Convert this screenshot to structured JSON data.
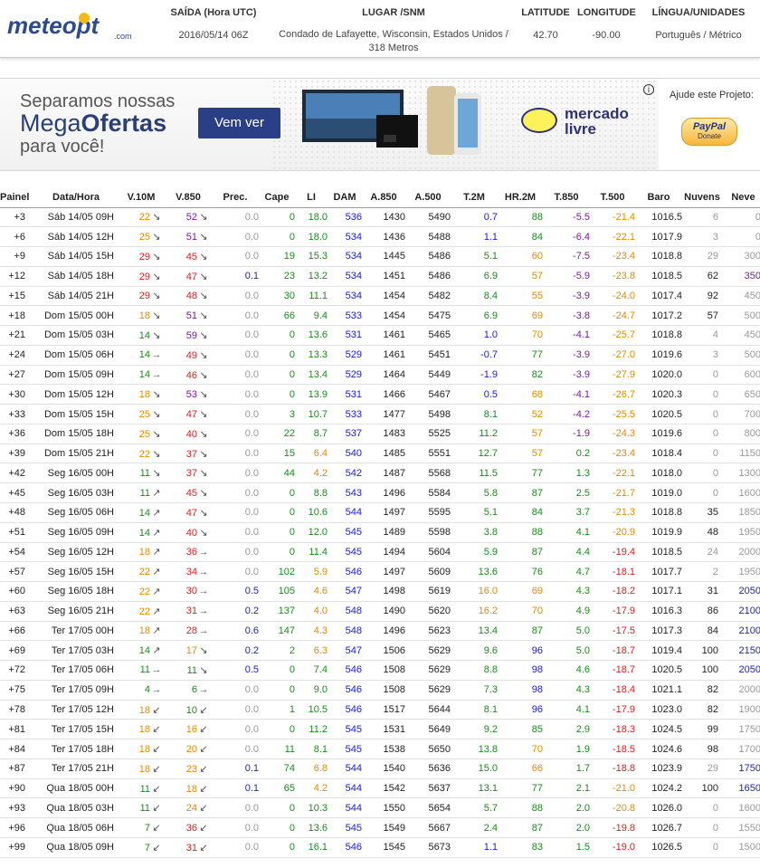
{
  "header": {
    "logo_text": "meteopt",
    "logo_suffix": ".com",
    "saida_label": "SAÍDA (Hora UTC)",
    "saida_value": "2016/05/14 06Z",
    "lugar_label": "LUGAR /SNM",
    "lugar_value_line1": "Condado de Lafayette, Wisconsin, Estados Unidos /",
    "lugar_value_line2": "318 Metros",
    "latitude_label": "LATITUDE",
    "latitude_value": "42.70",
    "longitude_label": "LONGITUDE",
    "longitude_value": "-90.00",
    "lingua_label": "LÍNGUA/UNIDADES",
    "lingua_value": "Português / Métrico"
  },
  "banner": {
    "line1": "Separamos nossas",
    "line2a": "Mega",
    "line2b": "Ofertas",
    "line3": "para você!",
    "button": "Vem ver",
    "brand_line1": "mercado",
    "brand_line2": "livre",
    "info_icon": "i",
    "support_text": "Ajude este Projeto:",
    "paypal_line1": "PayPal",
    "paypal_line2": "Donate"
  },
  "colors": {
    "green": "#1a8a1a",
    "orange": "#e08a00",
    "red": "#d42020",
    "purple": "#7a1aa0",
    "blue": "#1a1adc",
    "gray": "#999999"
  },
  "table": {
    "headers": [
      "Painel",
      "Data/Hora",
      "V.10M",
      "V.850",
      "Prec.",
      "Cape",
      "LI",
      "DAM",
      "A.850",
      "A.500",
      "T.2M",
      "HR.2M",
      "T.850",
      "T.500",
      "Baro",
      "Nuvens",
      "Neve"
    ],
    "rows": [
      [
        "+3",
        "Sáb 14/05 09H",
        "22",
        "↘",
        "52",
        "↘",
        "0.0",
        "0",
        "18.0",
        "536",
        "1430",
        "5490",
        "0.7",
        "88",
        "-5.5",
        "-21.4",
        "1016.5",
        "6",
        "0"
      ],
      [
        "+6",
        "Sáb 14/05 12H",
        "25",
        "↘",
        "51",
        "↘",
        "0.0",
        "0",
        "18.0",
        "534",
        "1436",
        "5488",
        "1.1",
        "84",
        "-6.4",
        "-22.1",
        "1017.9",
        "3",
        "0"
      ],
      [
        "+9",
        "Sáb 14/05 15H",
        "29",
        "↘",
        "45",
        "↘",
        "0.0",
        "19",
        "15.3",
        "534",
        "1445",
        "5486",
        "5.1",
        "60",
        "-7.5",
        "-23.4",
        "1018.8",
        "29",
        "300"
      ],
      [
        "+12",
        "Sáb 14/05 18H",
        "29",
        "↘",
        "47",
        "↘",
        "0.1",
        "23",
        "13.2",
        "534",
        "1451",
        "5486",
        "6.9",
        "57",
        "-5.9",
        "-23.8",
        "1018.5",
        "62",
        "350"
      ],
      [
        "+15",
        "Sáb 14/05 21H",
        "29",
        "↘",
        "48",
        "↘",
        "0.0",
        "30",
        "11.1",
        "534",
        "1454",
        "5482",
        "8.4",
        "55",
        "-3.9",
        "-24.0",
        "1017.4",
        "92",
        "450"
      ],
      [
        "+18",
        "Dom 15/05 00H",
        "18",
        "↘",
        "51",
        "↘",
        "0.0",
        "66",
        "9.4",
        "533",
        "1454",
        "5475",
        "6.9",
        "69",
        "-3.8",
        "-24.7",
        "1017.2",
        "57",
        "500"
      ],
      [
        "+21",
        "Dom 15/05 03H",
        "14",
        "↘",
        "59",
        "↘",
        "0.0",
        "0",
        "13.6",
        "531",
        "1461",
        "5465",
        "1.0",
        "70",
        "-4.1",
        "-25.7",
        "1018.8",
        "4",
        "450"
      ],
      [
        "+24",
        "Dom 15/05 06H",
        "14",
        "→",
        "49",
        "↘",
        "0.0",
        "0",
        "13.3",
        "529",
        "1461",
        "5451",
        "-0.7",
        "77",
        "-3.9",
        "-27.0",
        "1019.6",
        "3",
        "500"
      ],
      [
        "+27",
        "Dom 15/05 09H",
        "14",
        "→",
        "46",
        "↘",
        "0.0",
        "0",
        "13.4",
        "529",
        "1464",
        "5449",
        "-1.9",
        "82",
        "-3.9",
        "-27.9",
        "1020.0",
        "0",
        "600"
      ],
      [
        "+30",
        "Dom 15/05 12H",
        "18",
        "↘",
        "53",
        "↘",
        "0.0",
        "0",
        "13.9",
        "531",
        "1466",
        "5467",
        "0.5",
        "68",
        "-4.1",
        "-26.7",
        "1020.3",
        "0",
        "650"
      ],
      [
        "+33",
        "Dom 15/05 15H",
        "25",
        "↘",
        "47",
        "↘",
        "0.0",
        "3",
        "10.7",
        "533",
        "1477",
        "5498",
        "8.1",
        "52",
        "-4.2",
        "-25.5",
        "1020.5",
        "0",
        "700"
      ],
      [
        "+36",
        "Dom 15/05 18H",
        "25",
        "↘",
        "40",
        "↘",
        "0.0",
        "22",
        "8.7",
        "537",
        "1483",
        "5525",
        "11.2",
        "57",
        "-1.9",
        "-24.3",
        "1019.6",
        "0",
        "800"
      ],
      [
        "+39",
        "Dom 15/05 21H",
        "22",
        "↘",
        "37",
        "↘",
        "0.0",
        "15",
        "6.4",
        "540",
        "1485",
        "5551",
        "12.7",
        "57",
        "0.2",
        "-23.4",
        "1018.4",
        "0",
        "1150"
      ],
      [
        "+42",
        "Seg 16/05 00H",
        "11",
        "↘",
        "37",
        "↘",
        "0.0",
        "44",
        "4.2",
        "542",
        "1487",
        "5568",
        "11.5",
        "77",
        "1.3",
        "-22.1",
        "1018.0",
        "0",
        "1300"
      ],
      [
        "+45",
        "Seg 16/05 03H",
        "11",
        "↗",
        "45",
        "↘",
        "0.0",
        "0",
        "8.8",
        "543",
        "1496",
        "5584",
        "5.8",
        "87",
        "2.5",
        "-21.7",
        "1019.0",
        "0",
        "1600"
      ],
      [
        "+48",
        "Seg 16/05 06H",
        "14",
        "↗",
        "47",
        "↘",
        "0.0",
        "0",
        "10.6",
        "544",
        "1497",
        "5595",
        "5.1",
        "84",
        "3.7",
        "-21.3",
        "1018.8",
        "35",
        "1850"
      ],
      [
        "+51",
        "Seg 16/05 09H",
        "14",
        "↗",
        "40",
        "↘",
        "0.0",
        "0",
        "12.0",
        "545",
        "1489",
        "5598",
        "3.8",
        "88",
        "4.1",
        "-20.9",
        "1019.9",
        "48",
        "1950"
      ],
      [
        "+54",
        "Seg 16/05 12H",
        "18",
        "↗",
        "36",
        "→",
        "0.0",
        "0",
        "11.4",
        "545",
        "1494",
        "5604",
        "5.9",
        "87",
        "4.4",
        "-19.4",
        "1018.5",
        "24",
        "2000"
      ],
      [
        "+57",
        "Seg 16/05 15H",
        "22",
        "↗",
        "34",
        "→",
        "0.0",
        "102",
        "5.9",
        "546",
        "1497",
        "5609",
        "13.6",
        "76",
        "4.7",
        "-18.1",
        "1017.7",
        "2",
        "1950"
      ],
      [
        "+60",
        "Seg 16/05 18H",
        "22",
        "↗",
        "30",
        "→",
        "0.5",
        "105",
        "4.6",
        "547",
        "1498",
        "5619",
        "16.0",
        "69",
        "4.3",
        "-18.2",
        "1017.1",
        "31",
        "2050"
      ],
      [
        "+63",
        "Seg 16/05 21H",
        "22",
        "↗",
        "31",
        "→",
        "0.2",
        "137",
        "4.0",
        "548",
        "1490",
        "5620",
        "16.2",
        "70",
        "4.9",
        "-17.9",
        "1016.3",
        "86",
        "2100"
      ],
      [
        "+66",
        "Ter 17/05 00H",
        "18",
        "↗",
        "28",
        "→",
        "0.6",
        "147",
        "4.3",
        "548",
        "1496",
        "5623",
        "13.4",
        "87",
        "5.0",
        "-17.5",
        "1017.3",
        "84",
        "2100"
      ],
      [
        "+69",
        "Ter 17/05 03H",
        "14",
        "↗",
        "17",
        "↘",
        "0.2",
        "2",
        "6.3",
        "547",
        "1506",
        "5629",
        "9.6",
        "96",
        "5.0",
        "-18.7",
        "1019.4",
        "100",
        "2150"
      ],
      [
        "+72",
        "Ter 17/05 06H",
        "11",
        "→",
        "11",
        "↘",
        "0.5",
        "0",
        "7.4",
        "546",
        "1508",
        "5629",
        "8.8",
        "98",
        "4.6",
        "-18.7",
        "1020.5",
        "100",
        "2050"
      ],
      [
        "+75",
        "Ter 17/05 09H",
        "4",
        "→",
        "6",
        "→",
        "0.0",
        "0",
        "9.0",
        "546",
        "1508",
        "5629",
        "7.3",
        "98",
        "4.3",
        "-18.4",
        "1021.1",
        "82",
        "2000"
      ],
      [
        "+78",
        "Ter 17/05 12H",
        "18",
        "↙",
        "10",
        "↙",
        "0.0",
        "1",
        "10.5",
        "546",
        "1517",
        "5644",
        "8.1",
        "96",
        "4.1",
        "-17.9",
        "1023.0",
        "82",
        "1900"
      ],
      [
        "+81",
        "Ter 17/05 15H",
        "18",
        "↙",
        "16",
        "↙",
        "0.0",
        "0",
        "11.2",
        "545",
        "1531",
        "5649",
        "9.2",
        "85",
        "2.9",
        "-18.3",
        "1024.5",
        "99",
        "1750"
      ],
      [
        "+84",
        "Ter 17/05 18H",
        "18",
        "↙",
        "20",
        "↙",
        "0.0",
        "11",
        "8.1",
        "545",
        "1538",
        "5650",
        "13.8",
        "70",
        "1.9",
        "-18.5",
        "1024.6",
        "98",
        "1700"
      ],
      [
        "+87",
        "Ter 17/05 21H",
        "18",
        "↙",
        "23",
        "↙",
        "0.1",
        "74",
        "6.8",
        "544",
        "1540",
        "5636",
        "15.0",
        "66",
        "1.7",
        "-18.8",
        "1023.9",
        "29",
        "1750"
      ],
      [
        "+90",
        "Qua 18/05 00H",
        "11",
        "↙",
        "18",
        "↙",
        "0.1",
        "65",
        "4.2",
        "544",
        "1542",
        "5637",
        "13.1",
        "77",
        "2.1",
        "-21.0",
        "1024.2",
        "100",
        "1650"
      ],
      [
        "+93",
        "Qua 18/05 03H",
        "11",
        "↙",
        "24",
        "↙",
        "0.0",
        "0",
        "10.3",
        "544",
        "1550",
        "5654",
        "5.7",
        "88",
        "2.0",
        "-20.8",
        "1026.0",
        "0",
        "1600"
      ],
      [
        "+96",
        "Qua 18/05 06H",
        "7",
        "↙",
        "36",
        "↙",
        "0.0",
        "0",
        "13.6",
        "545",
        "1549",
        "5667",
        "2.4",
        "87",
        "2.0",
        "-19.8",
        "1026.7",
        "0",
        "1550"
      ],
      [
        "+99",
        "Qua 18/05 09H",
        "7",
        "↙",
        "31",
        "↙",
        "0.0",
        "0",
        "16.1",
        "546",
        "1545",
        "5673",
        "1.1",
        "83",
        "1.5",
        "-19.0",
        "1026.5",
        "0",
        "1500"
      ]
    ]
  }
}
